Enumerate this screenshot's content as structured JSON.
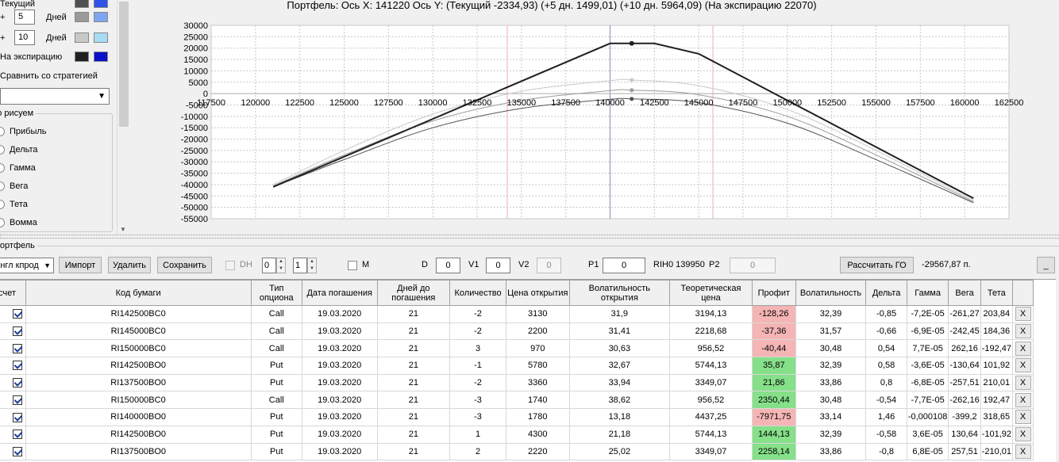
{
  "left_panel": {
    "current_label": "Текущий",
    "current_colors": [
      "#505050",
      "#2f52e8"
    ],
    "plus1_sign": "+",
    "plus1_days": "5",
    "plus1_unit": "Дней",
    "plus1_colors": [
      "#9a9a9a",
      "#7ea6f0"
    ],
    "plus2_sign": "+",
    "plus2_days": "10",
    "plus2_unit": "Дней",
    "plus2_colors": [
      "#c8c8c8",
      "#a7dcf5"
    ],
    "expiry_label": "На экспирацию",
    "expiry_colors": [
      "#202020",
      "#0a10c8"
    ],
    "compare_label": "Сравнить со стратегией",
    "compare_value": "",
    "draw_group_title": "Что рисуем",
    "draw_options": [
      "Прибыль",
      "Дельта",
      "Гамма",
      "Вега",
      "Тета",
      "Вомма"
    ]
  },
  "chart": {
    "title": "Портфель: Ось X: 141220 Ось Y: (Текущий -2334,93) (+5 дн. 1499,01) (+10 дн. 5964,09) (На экспирацию 22070)",
    "x_ticks": [
      "117500",
      "120000",
      "122500",
      "125000",
      "127500",
      "130000",
      "132500",
      "135000",
      "137500",
      "140000",
      "142500",
      "145000",
      "147500",
      "150000",
      "152500",
      "155000",
      "157500",
      "160000",
      "162500"
    ],
    "y_ticks": [
      "30000",
      "25000",
      "20000",
      "15000",
      "10000",
      "5000",
      "0",
      "-5000",
      "-10000",
      "-15000",
      "-20000",
      "-25000",
      "-30000",
      "-35000",
      "-40000",
      "-45000",
      "-50000",
      "-55000"
    ]
  },
  "chart_data": {
    "type": "line",
    "title": "Портфель: Ось X: 141220 Ось Y: (Текущий -2334,93) (+5 дн. 1499,01) (+10 дн. 5964,09) (На экспирацию 22070)",
    "xlim": [
      117500,
      162500
    ],
    "ylim": [
      -55000,
      30000
    ],
    "grid": true,
    "cursor_x": 141220,
    "series": [
      {
        "name": "На экспирацию",
        "color": "#202020",
        "x": [
          121000,
          140000,
          142500,
          145000,
          160500
        ],
        "y": [
          -41000,
          22070,
          22070,
          17500,
          -46000
        ]
      },
      {
        "name": "+10 дн.",
        "color": "#c8c8c8",
        "x": [
          121000,
          125000,
          130000,
          135000,
          140000,
          141220,
          145000,
          150000,
          155000,
          160500
        ],
        "y": [
          -40000,
          -25000,
          -9000,
          1000,
          5700,
          5964,
          3500,
          -7000,
          -25000,
          -47000
        ]
      },
      {
        "name": "+5 дн.",
        "color": "#9a9a9a",
        "x": [
          121000,
          125000,
          130000,
          135000,
          140000,
          141220,
          145000,
          150000,
          155000,
          160500
        ],
        "y": [
          -40500,
          -27000,
          -12000,
          -3000,
          1300,
          1499,
          -500,
          -10000,
          -27000,
          -47500
        ]
      },
      {
        "name": "Текущий",
        "color": "#505050",
        "x": [
          121000,
          125000,
          130000,
          135000,
          140000,
          141220,
          145000,
          150000,
          155000,
          160500
        ],
        "y": [
          -41000,
          -29000,
          -15000,
          -6500,
          -2500,
          -2335,
          -4000,
          -13000,
          -29000,
          -48000
        ]
      }
    ],
    "vlines": [
      {
        "x": 134200,
        "color": "#f4b8c4"
      },
      {
        "x": 140000,
        "color": "#9a9ab8"
      },
      {
        "x": 145800,
        "color": "#f4b8c4"
      }
    ],
    "cursor_points": [
      {
        "x": 141220,
        "y": 22070
      },
      {
        "x": 141220,
        "y": 5964
      },
      {
        "x": 141220,
        "y": 1499
      },
      {
        "x": 141220,
        "y": -2335
      }
    ]
  },
  "portfolio": {
    "group_title": "Портфель",
    "combo_value": "Англ кпрод",
    "btn_import": "Импорт",
    "btn_delete": "Удалить",
    "btn_save": "Сохранить",
    "dh_label": "DH",
    "spin1": "0",
    "spin2": "1",
    "m_label": "M",
    "d_label": "D",
    "d_value": "0",
    "v1_label": "V1",
    "v1_value": "0",
    "v2_label": "V2",
    "v2_value": "0",
    "p1_label": "P1",
    "p1_value": "0",
    "rih_label": "RIH0 139950",
    "p2_label": "P2",
    "p2_value": "0",
    "btn_go": "Рассчитать ГО",
    "go_value": "-29567,87 п.",
    "btn_min": "_"
  },
  "table": {
    "columns": [
      "Расчет",
      "Код бумаги",
      "Тип опциона",
      "Дата погашения",
      "Дней до погашения",
      "Количество",
      "Цена открытия",
      "Волатильность открытия",
      "Теоретическая цена",
      "Профит",
      "Волатильность",
      "Дельта",
      "Гамма",
      "Вега",
      "Тета",
      ""
    ],
    "rows": [
      {
        "code": "RI142500BC0",
        "type": "Call",
        "date": "19.03.2020",
        "days": "21",
        "qty": "-2",
        "open": "3130",
        "vol_open": "31,9",
        "theo": "3194,13",
        "profit": "-128,26",
        "vol": "32,39",
        "delta": "-0,85",
        "gamma": "-7,2E-05",
        "vega": "-261,27",
        "theta": "203,84",
        "x": "X"
      },
      {
        "code": "RI145000BC0",
        "type": "Call",
        "date": "19.03.2020",
        "days": "21",
        "qty": "-2",
        "open": "2200",
        "vol_open": "31,41",
        "theo": "2218,68",
        "profit": "-37,36",
        "vol": "31,57",
        "delta": "-0,66",
        "gamma": "-6,9E-05",
        "vega": "-242,45",
        "theta": "184,36",
        "x": "X"
      },
      {
        "code": "RI150000BC0",
        "type": "Call",
        "date": "19.03.2020",
        "days": "21",
        "qty": "3",
        "open": "970",
        "vol_open": "30,63",
        "theo": "956,52",
        "profit": "-40,44",
        "vol": "30,48",
        "delta": "0,54",
        "gamma": "7,7E-05",
        "vega": "262,16",
        "theta": "-192,47",
        "x": "X"
      },
      {
        "code": "RI142500BO0",
        "type": "Put",
        "date": "19.03.2020",
        "days": "21",
        "qty": "-1",
        "open": "5780",
        "vol_open": "32,67",
        "theo": "5744,13",
        "profit": "35,87",
        "vol": "32,39",
        "delta": "0,58",
        "gamma": "-3,6E-05",
        "vega": "-130,64",
        "theta": "101,92",
        "x": "X"
      },
      {
        "code": "RI137500BO0",
        "type": "Put",
        "date": "19.03.2020",
        "days": "21",
        "qty": "-2",
        "open": "3360",
        "vol_open": "33,94",
        "theo": "3349,07",
        "profit": "21,86",
        "vol": "33,86",
        "delta": "0,8",
        "gamma": "-6,8E-05",
        "vega": "-257,51",
        "theta": "210,01",
        "x": "X"
      },
      {
        "code": "RI150000BC0",
        "type": "Call",
        "date": "19.03.2020",
        "days": "21",
        "qty": "-3",
        "open": "1740",
        "vol_open": "38,62",
        "theo": "956,52",
        "profit": "2350,44",
        "vol": "30,48",
        "delta": "-0,54",
        "gamma": "-7,7E-05",
        "vega": "-262,16",
        "theta": "192,47",
        "x": "X"
      },
      {
        "code": "RI140000BO0",
        "type": "Put",
        "date": "19.03.2020",
        "days": "21",
        "qty": "-3",
        "open": "1780",
        "vol_open": "13,18",
        "theo": "4437,25",
        "profit": "-7971,75",
        "vol": "33,14",
        "delta": "1,46",
        "gamma": "-0,000108",
        "vega": "-399,2",
        "theta": "318,65",
        "x": "X"
      },
      {
        "code": "RI142500BO0",
        "type": "Put",
        "date": "19.03.2020",
        "days": "21",
        "qty": "1",
        "open": "4300",
        "vol_open": "21,18",
        "theo": "5744,13",
        "profit": "1444,13",
        "vol": "32,39",
        "delta": "-0,58",
        "gamma": "3,6E-05",
        "vega": "130,64",
        "theta": "-101,92",
        "x": "X"
      },
      {
        "code": "RI137500BO0",
        "type": "Put",
        "date": "19.03.2020",
        "days": "21",
        "qty": "2",
        "open": "2220",
        "vol_open": "25,02",
        "theo": "3349,07",
        "profit": "2258,14",
        "vol": "33,86",
        "delta": "-0,8",
        "gamma": "6,8E-05",
        "vega": "257,51",
        "theta": "-210,01",
        "x": "X"
      }
    ]
  }
}
